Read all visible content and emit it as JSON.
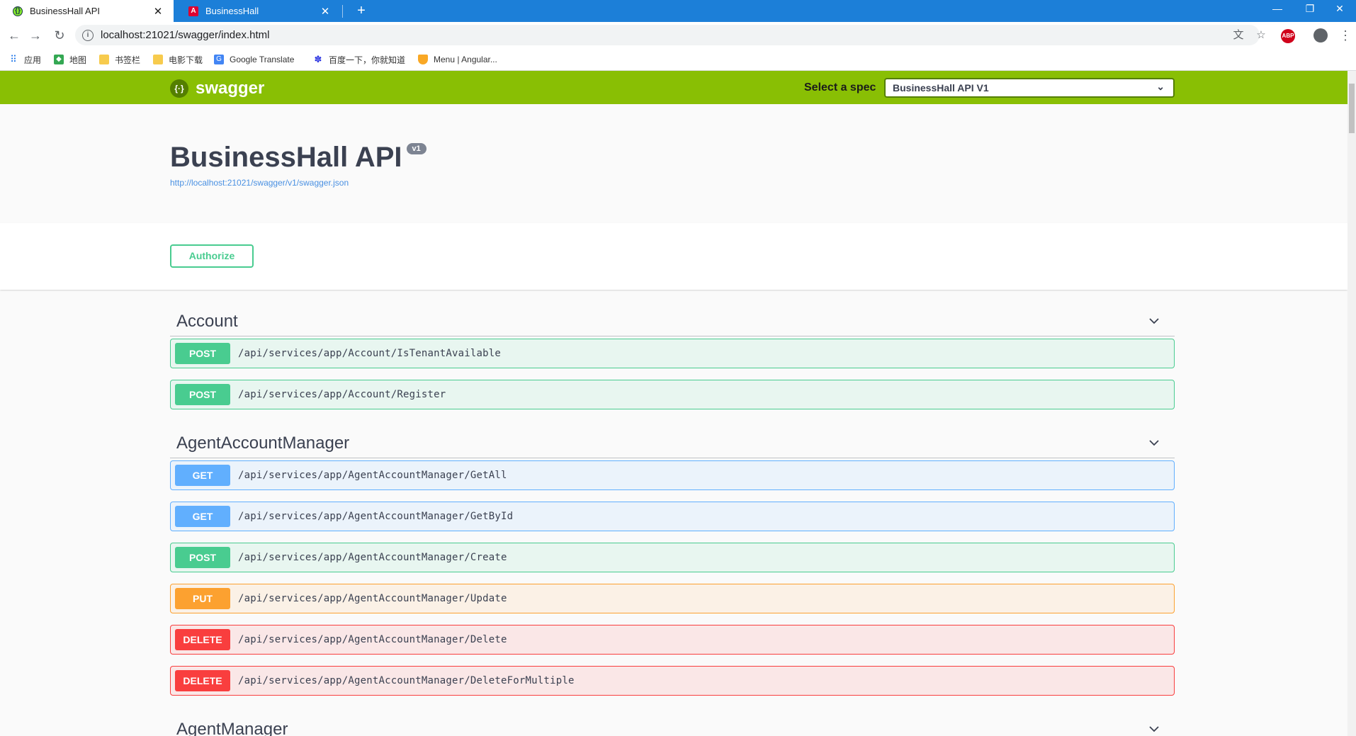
{
  "browser": {
    "tabs": [
      {
        "title": "BusinessHall API",
        "active": true
      },
      {
        "title": "BusinessHall",
        "active": false
      }
    ],
    "url": "localhost:21021/swagger/index.html",
    "bookmarks": [
      "应用",
      "地图",
      "书签栏",
      "电影下载",
      "Google Translate",
      "百度一下，你就知道",
      "Menu | Angular..."
    ]
  },
  "swagger": {
    "logo_text": "swagger",
    "spec_label": "Select a spec",
    "spec_selected": "BusinessHall API V1",
    "title": "BusinessHall API",
    "version": "v1",
    "spec_url": "http://localhost:21021/swagger/v1/swagger.json",
    "authorize_label": "Authorize"
  },
  "tags": [
    {
      "name": "Account",
      "operations": [
        {
          "method": "POST",
          "path": "/api/services/app/Account/IsTenantAvailable"
        },
        {
          "method": "POST",
          "path": "/api/services/app/Account/Register"
        }
      ]
    },
    {
      "name": "AgentAccountManager",
      "operations": [
        {
          "method": "GET",
          "path": "/api/services/app/AgentAccountManager/GetAll"
        },
        {
          "method": "GET",
          "path": "/api/services/app/AgentAccountManager/GetById"
        },
        {
          "method": "POST",
          "path": "/api/services/app/AgentAccountManager/Create"
        },
        {
          "method": "PUT",
          "path": "/api/services/app/AgentAccountManager/Update"
        },
        {
          "method": "DELETE",
          "path": "/api/services/app/AgentAccountManager/Delete"
        },
        {
          "method": "DELETE",
          "path": "/api/services/app/AgentAccountManager/DeleteForMultiple"
        }
      ]
    },
    {
      "name": "AgentManager",
      "operations": []
    }
  ],
  "colors": {
    "topbar": "#89bf04",
    "post": "#49cc90",
    "get": "#61affe",
    "put": "#fca130",
    "delete": "#f93e3e"
  }
}
